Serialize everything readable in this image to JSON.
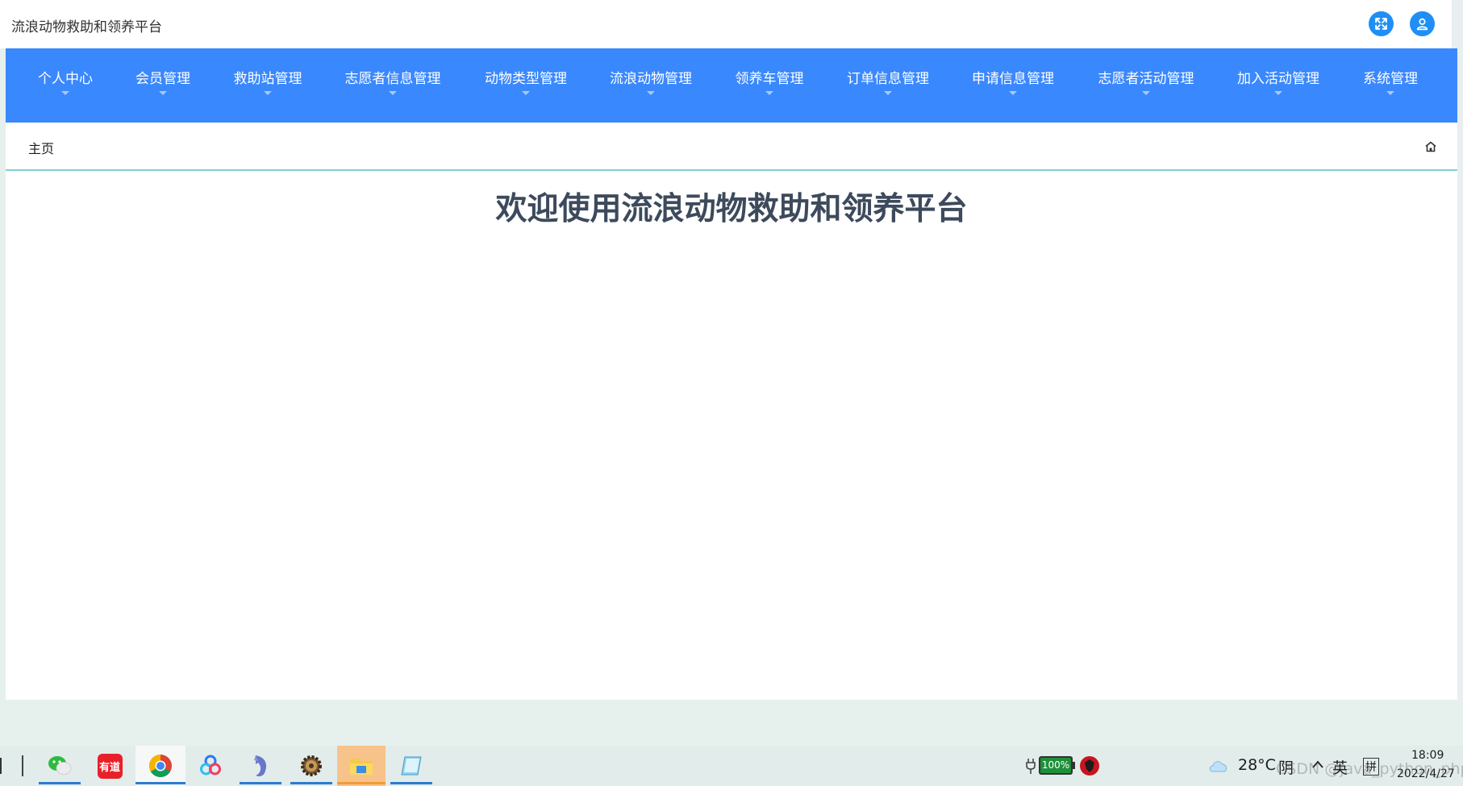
{
  "header": {
    "app_title": "流浪动物救助和领养平台"
  },
  "nav": {
    "items": [
      {
        "label": "个人中心",
        "name": "nav-item-personal-center"
      },
      {
        "label": "会员管理",
        "name": "nav-item-member-management"
      },
      {
        "label": "救助站管理",
        "name": "nav-item-rescue-station-management"
      },
      {
        "label": "志愿者信息管理",
        "name": "nav-item-volunteer-info-management"
      },
      {
        "label": "动物类型管理",
        "name": "nav-item-animal-type-management"
      },
      {
        "label": "流浪动物管理",
        "name": "nav-item-stray-animal-management"
      },
      {
        "label": "领养车管理",
        "name": "nav-item-adoption-cart-management"
      },
      {
        "label": "订单信息管理",
        "name": "nav-item-order-info-management"
      },
      {
        "label": "申请信息管理",
        "name": "nav-item-application-info-management"
      },
      {
        "label": "志愿者活动管理",
        "name": "nav-item-volunteer-activity-management"
      },
      {
        "label": "加入活动管理",
        "name": "nav-item-join-activity-management"
      },
      {
        "label": "系统管理",
        "name": "nav-item-system-management"
      }
    ]
  },
  "breadcrumb": {
    "current": "主页"
  },
  "main": {
    "welcome": "欢迎使用流浪动物救助和领养平台"
  },
  "taskbar": {
    "apps": [
      {
        "name": "wechat-icon"
      },
      {
        "name": "youdao-icon",
        "text": "有道"
      },
      {
        "name": "chrome-icon"
      },
      {
        "name": "baidu-netdisk-icon"
      },
      {
        "name": "dolphin-app-icon"
      },
      {
        "name": "gear-app-icon"
      },
      {
        "name": "file-explorer-icon"
      },
      {
        "name": "notepad-icon"
      }
    ],
    "battery": "100%",
    "temperature": "28°C",
    "weather": "阴",
    "ime_lang": "英",
    "ime_mode": "拼",
    "time": "18:09",
    "date": "2022/4/27",
    "watermark": "CSDN @java_python_php"
  }
}
